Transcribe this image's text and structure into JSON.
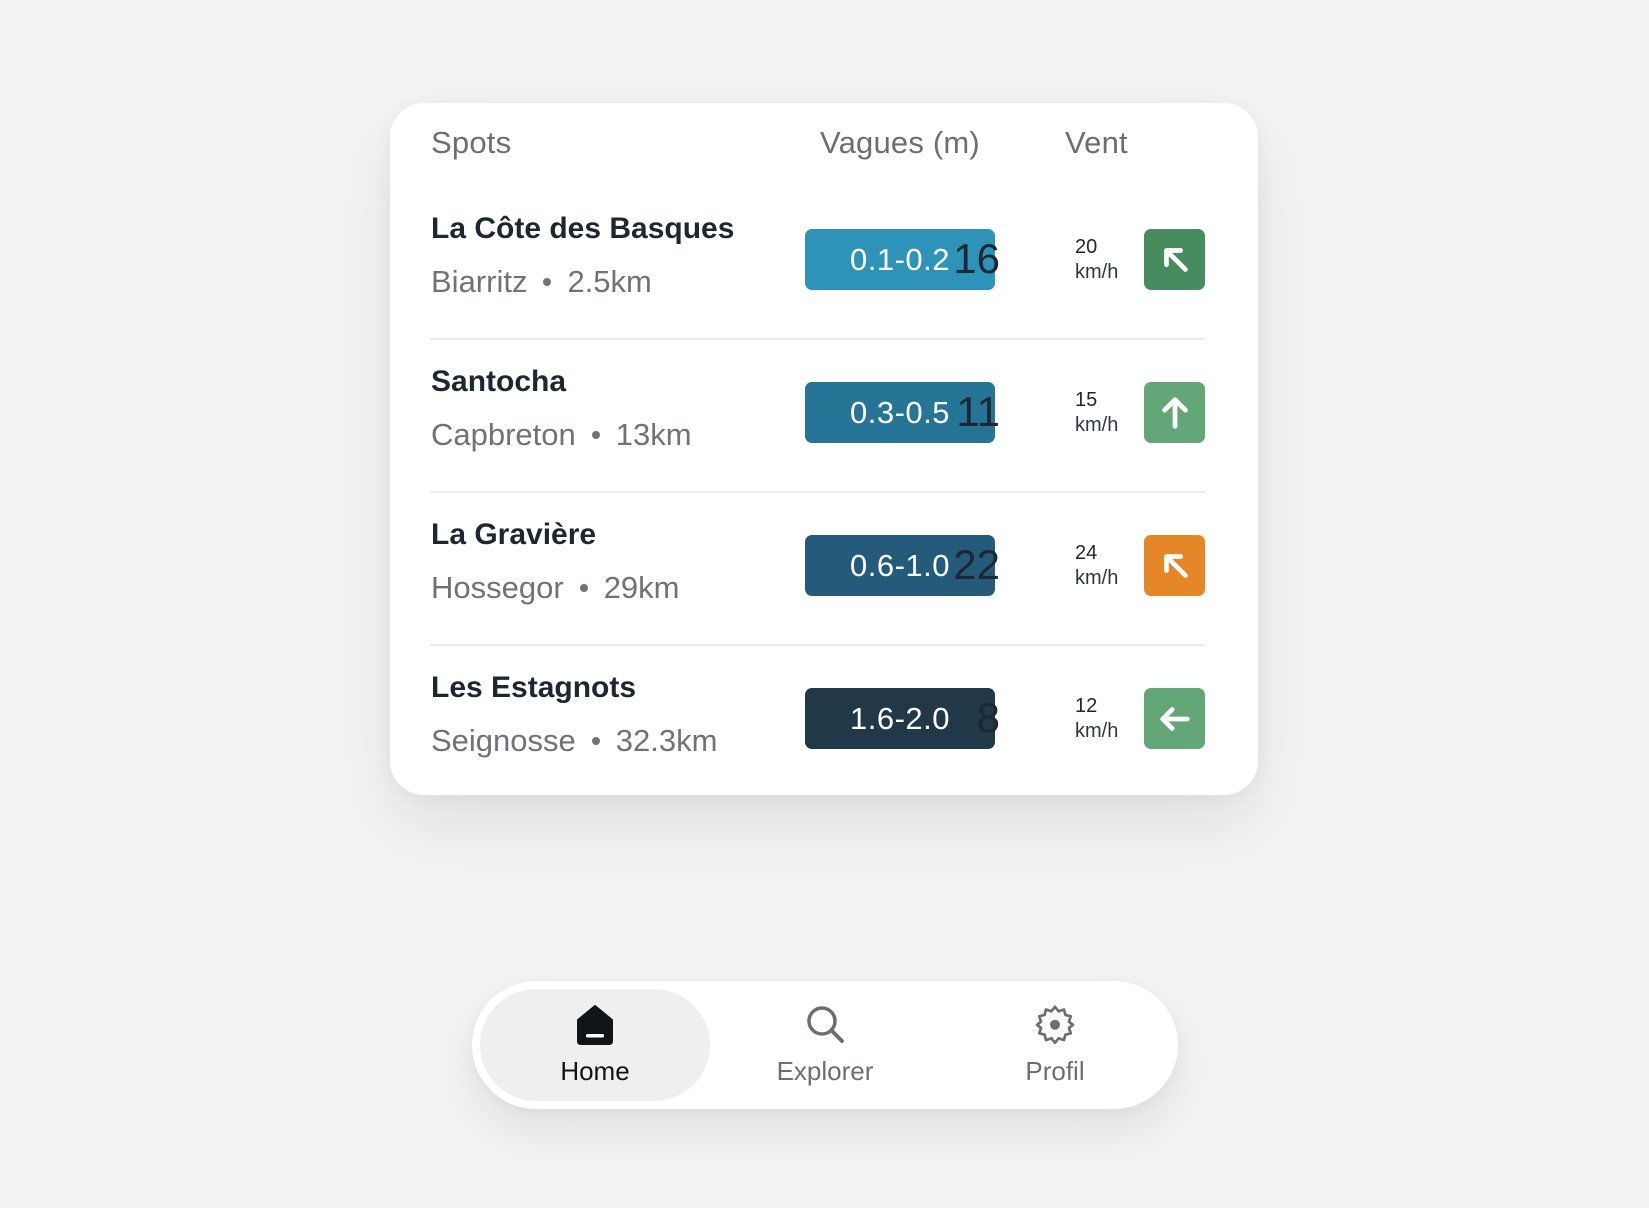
{
  "table": {
    "headers": {
      "spots": "Spots",
      "waves": "Vagues (m)",
      "wind": "Vent"
    },
    "rows": [
      {
        "name": "La Côte des Basques",
        "location": "Biarritz",
        "distance": "2.5km",
        "waves": "0.1-0.2",
        "waves_color": "#2e93b8",
        "wind_speed": "16",
        "wind_gust": "20",
        "wind_unit": "km/h",
        "wind_icon": "arrow-up-left-icon",
        "wind_color": "#468c5e"
      },
      {
        "name": "Santocha",
        "location": "Capbreton",
        "distance": "13km",
        "waves": "0.3-0.5",
        "waves_color": "#267496",
        "wind_speed": "11",
        "wind_gust": "15",
        "wind_unit": "km/h",
        "wind_icon": "arrow-up-icon",
        "wind_color": "#63a778"
      },
      {
        "name": "La Gravière",
        "location": "Hossegor",
        "distance": "29km",
        "waves": "0.6-1.0",
        "waves_color": "#245b7b",
        "wind_speed": "22",
        "wind_gust": "24",
        "wind_unit": "km/h",
        "wind_icon": "arrow-up-left-icon",
        "wind_color": "#e58727"
      },
      {
        "name": "Les Estagnots",
        "location": "Seignosse",
        "distance": "32.3km",
        "waves": "1.6-2.0",
        "waves_color": "#203848",
        "wind_speed": "8",
        "wind_gust": "12",
        "wind_unit": "km/h",
        "wind_icon": "arrow-left-icon",
        "wind_color": "#63a778"
      }
    ]
  },
  "nav": {
    "items": [
      {
        "label": "Home",
        "icon": "home-icon",
        "active": true
      },
      {
        "label": "Explorer",
        "icon": "search-icon",
        "active": false
      },
      {
        "label": "Profil",
        "icon": "gear-icon",
        "active": false
      }
    ]
  }
}
